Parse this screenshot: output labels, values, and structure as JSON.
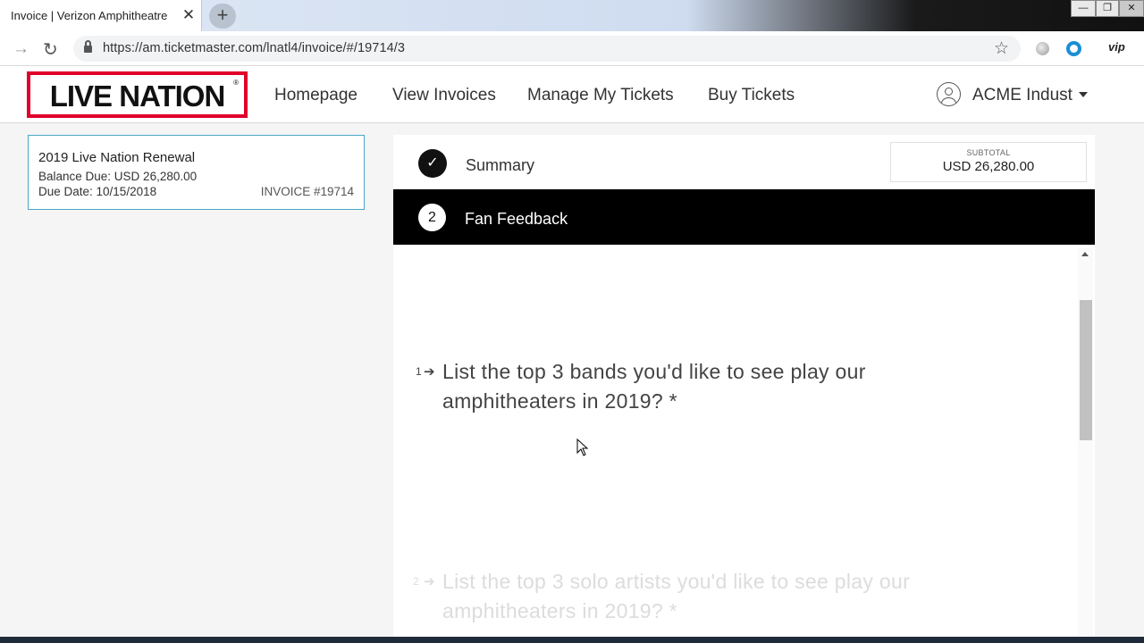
{
  "browser": {
    "tab_title": "Invoice | Verizon Amphitheatre",
    "tab_close": "✕",
    "new_tab": "+",
    "url": "https://am.ticketmaster.com/lnatl4/invoice/#/19714/3",
    "extension_label": "vip"
  },
  "header": {
    "logo_text": "LIVE NATION",
    "logo_reg": "®",
    "nav": [
      "Homepage",
      "View Invoices",
      "Manage My Tickets",
      "Buy Tickets"
    ],
    "user_name": "ACME Indust"
  },
  "invoice": {
    "title": "2019 Live Nation Renewal",
    "balance": "Balance Due: USD 26,280.00",
    "due_date": "Due Date: 10/15/2018",
    "number": "INVOICE #19714"
  },
  "steps": {
    "summary_label": "Summary",
    "subtotal_label": "SUBTOTAL",
    "subtotal_value": "USD 26,280.00",
    "current_num": "2",
    "current_label": "Fan Feedback"
  },
  "questions": [
    {
      "num": "1",
      "arrow": "➔",
      "text": "List the top 3 bands you'd like to see play our amphitheaters in 2019? *"
    },
    {
      "num": "2",
      "arrow": "➔",
      "text": "List the top 3 solo artists you'd like to see play our amphitheaters in 2019? *"
    }
  ],
  "colors": {
    "brand_red": "#e0002a",
    "card_border": "#49a8c8",
    "active_step_bg": "#000000"
  }
}
